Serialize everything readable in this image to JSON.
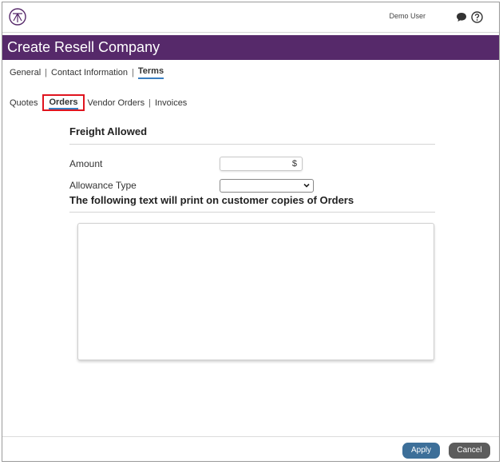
{
  "header": {
    "user_name": "Demo User",
    "icons": [
      "logo-icon",
      "chat-icon",
      "help-icon"
    ]
  },
  "page_title": "Create Resell Company",
  "main_tabs": [
    {
      "label": "General"
    },
    {
      "label": "Contact Information"
    },
    {
      "label": "Terms",
      "active": true
    }
  ],
  "sub_tabs": [
    {
      "label": "Quotes"
    },
    {
      "label": "Orders",
      "active": true
    },
    {
      "label": "Vendor Orders"
    },
    {
      "label": "Invoices"
    }
  ],
  "freight": {
    "title": "Freight Allowed",
    "amount_label": "Amount",
    "amount_value": "$",
    "allowance_label": "Allowance Type",
    "allowance_value": ""
  },
  "print_text": {
    "heading": "The following text will print on customer copies of Orders",
    "value": ""
  },
  "footer": {
    "apply_label": "Apply",
    "cancel_label": "Cancel"
  },
  "colors": {
    "title_bar": "#56296a",
    "highlight_box": "#e0141e",
    "tab_underline": "#3a7ec0",
    "apply_button": "#3d6f99",
    "cancel_button": "#5c5c5c"
  }
}
